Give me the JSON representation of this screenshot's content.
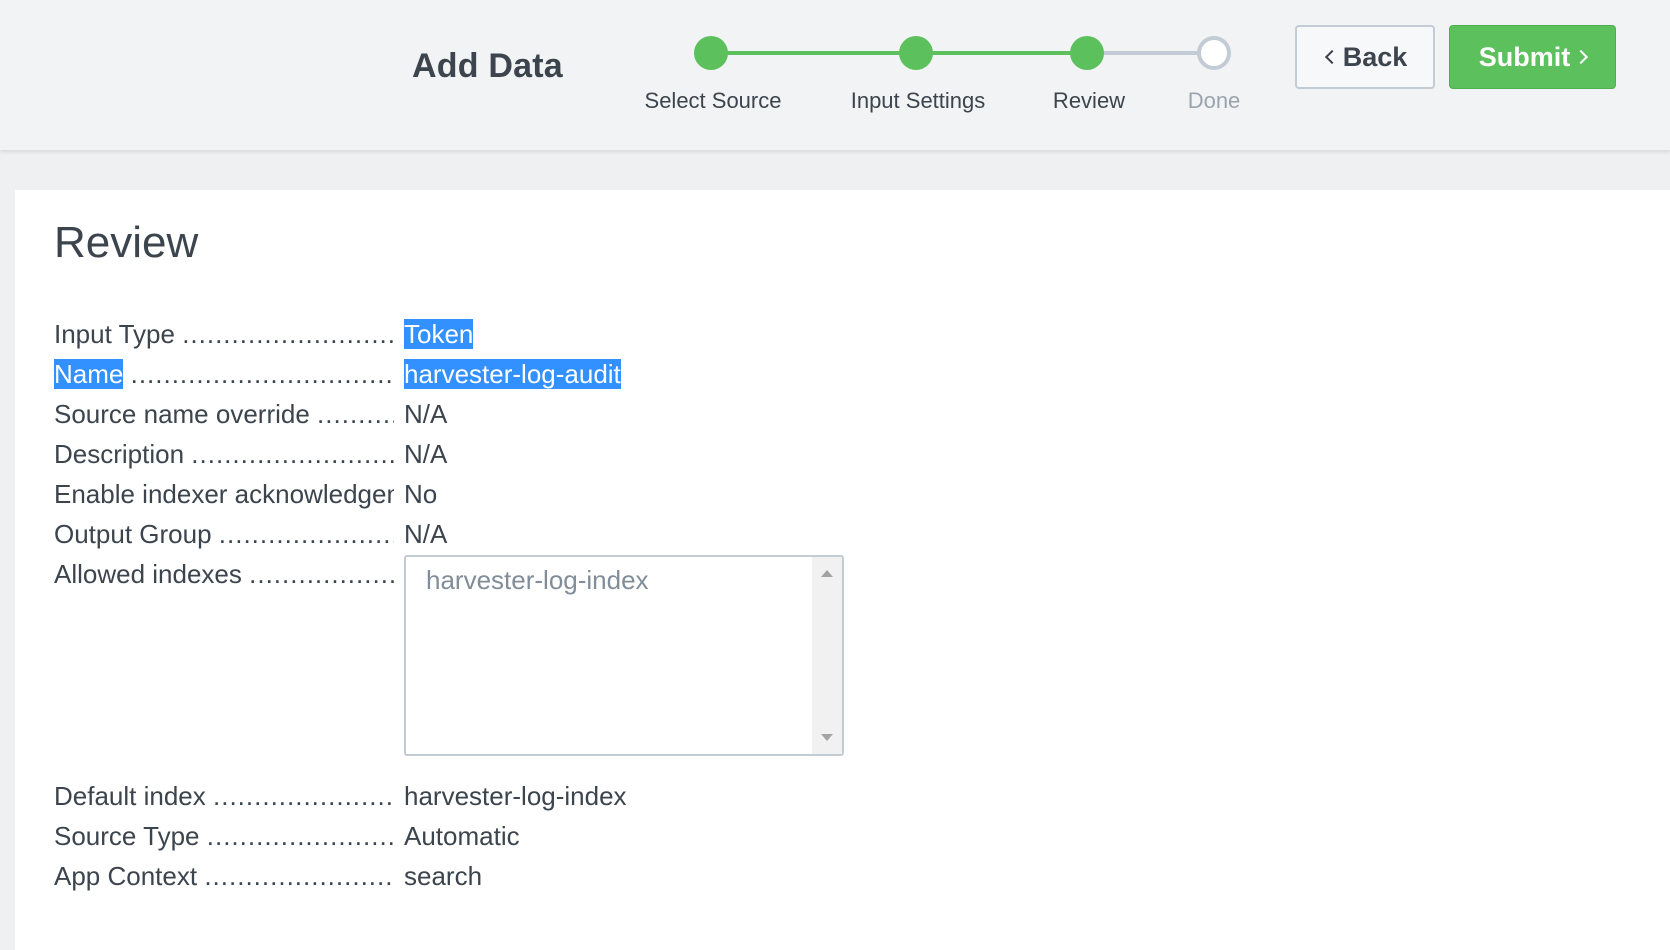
{
  "header": {
    "title": "Add Data",
    "steps": [
      {
        "label": "Select Source",
        "state": "complete"
      },
      {
        "label": "Input Settings",
        "state": "complete"
      },
      {
        "label": "Review",
        "state": "current"
      },
      {
        "label": "Done",
        "state": "pending"
      }
    ],
    "back_label": "Back",
    "submit_label": "Submit"
  },
  "review": {
    "title": "Review",
    "rows": [
      {
        "label": "Input Type",
        "value": "Token"
      },
      {
        "label": "Name",
        "value": "harvester-log-audit"
      },
      {
        "label": "Source name override",
        "value": "N/A"
      },
      {
        "label": "Description",
        "value": "N/A"
      },
      {
        "label": "Enable indexer acknowledgement",
        "value": "No"
      },
      {
        "label": "Output Group",
        "value": "N/A"
      },
      {
        "label": "Allowed indexes",
        "value": ""
      },
      {
        "label": "Default index",
        "value": "harvester-log-index"
      },
      {
        "label": "Source Type",
        "value": "Automatic"
      },
      {
        "label": "App Context",
        "value": "search"
      }
    ],
    "allowed_indexes": [
      "harvester-log-index"
    ]
  },
  "colors": {
    "step_complete": "#5cc05c",
    "step_pending": "#c3cbd4",
    "submit_bg": "#5cc05c",
    "highlight": "#3390ff"
  }
}
